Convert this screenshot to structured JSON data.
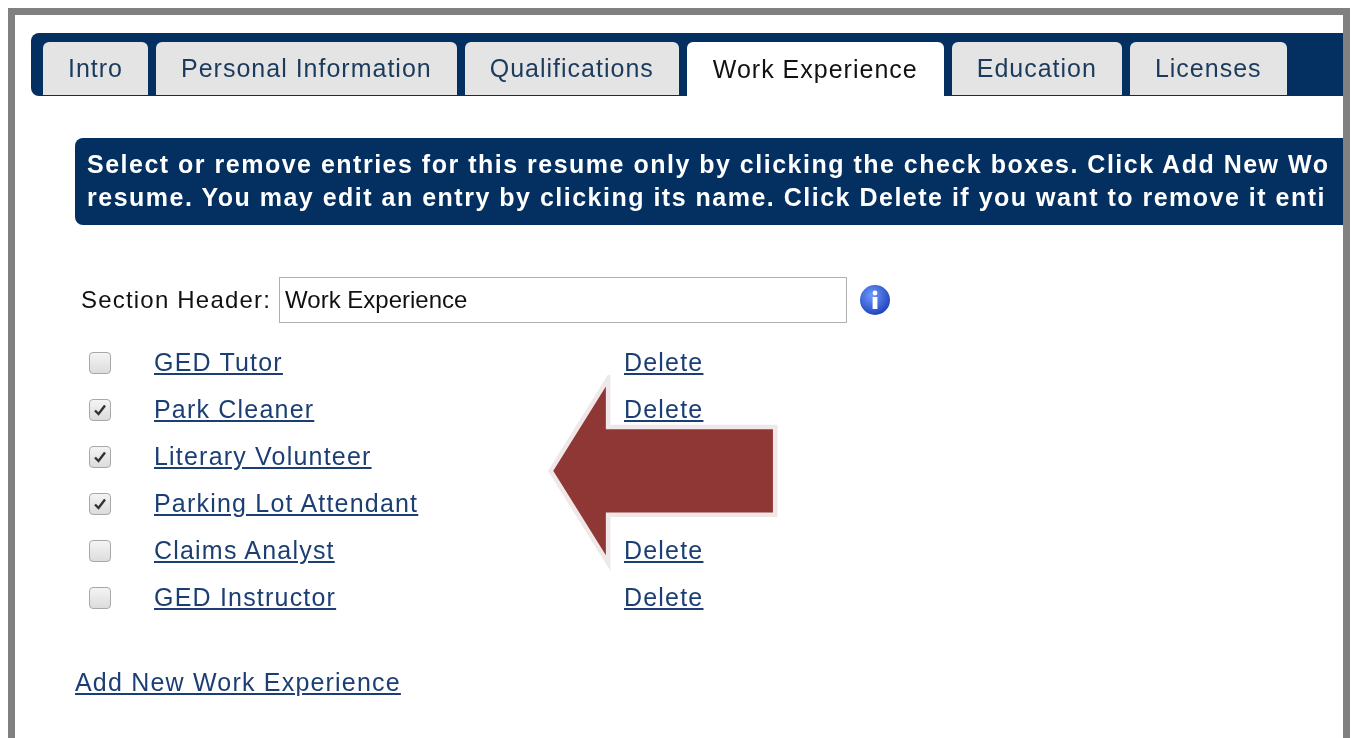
{
  "tabs": [
    {
      "label": "Intro",
      "selected": false
    },
    {
      "label": "Personal Information",
      "selected": false
    },
    {
      "label": "Qualifications",
      "selected": false
    },
    {
      "label": "Work Experience",
      "selected": true
    },
    {
      "label": "Education",
      "selected": false
    },
    {
      "label": "Licenses",
      "selected": false
    }
  ],
  "instructions": [
    "Select or remove entries for this resume only by clicking the check boxes. Click Add New Wo",
    "resume. You may edit an entry by clicking its name. Click Delete if you want to remove it enti"
  ],
  "section_header": {
    "label": "Section Header:",
    "value": "Work Experience"
  },
  "entries": [
    {
      "name": "GED Tutor",
      "checked": false,
      "delete": "Delete"
    },
    {
      "name": "Park Cleaner",
      "checked": true,
      "delete": "Delete"
    },
    {
      "name": "Literary Volunteer",
      "checked": true
    },
    {
      "name": "Parking Lot Attendant",
      "checked": true
    },
    {
      "name": "Claims Analyst",
      "checked": false,
      "delete": "Delete"
    },
    {
      "name": "GED Instructor",
      "checked": false,
      "delete": "Delete"
    }
  ],
  "add_link": "Add New Work Experience"
}
